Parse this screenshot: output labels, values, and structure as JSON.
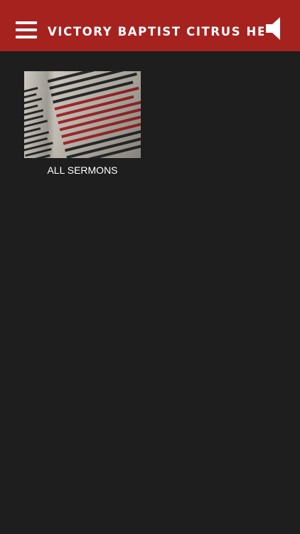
{
  "header": {
    "title": "VICTORY BAPTIST CITRUS HEIGHTS",
    "background_color": "#a6221f",
    "menu_icon": "hamburger-menu-icon",
    "audio_icon": "speaker-icon"
  },
  "main": {
    "background_color": "#1e1e1e",
    "tiles": [
      {
        "label": "ALL SERMONS",
        "image": "bible-page-photo"
      }
    ]
  }
}
